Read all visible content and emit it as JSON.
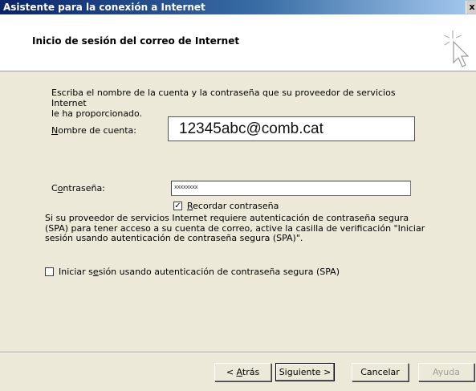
{
  "window": {
    "title": "Asistente para la conexión a Internet",
    "close_glyph": "x"
  },
  "header": {
    "heading": "Inicio de sesión del correo de Internet"
  },
  "form": {
    "intro_line1": "Escriba el nombre de la cuenta y la contraseña que su proveedor de servicios Internet",
    "intro_line2": "le ha proporcionado.",
    "account_label_key": "N",
    "account_label_rest": "ombre de cuenta:",
    "account_value": "12345abc@comb.cat",
    "password_label_pre": "C",
    "password_label_key": "o",
    "password_label_rest": "ntraseña:",
    "password_value": "xxxxxxxx",
    "remember_checked": true,
    "remember_label_key": "R",
    "remember_label_rest": "ecordar contraseña",
    "spa_line1": "Si su proveedor de servicios Internet requiere autenticación de contraseña segura",
    "spa_line2": "(SPA) para tener acceso a su cuenta de correo, active la casilla de verificación \"Iniciar",
    "spa_line3": "sesión usando autenticación de contraseña segura (SPA)\".",
    "spa_checked": false,
    "spa_label_pre": "Iniciar s",
    "spa_label_key": "e",
    "spa_label_rest": "sión usando autenticación de contraseña segura (SPA)"
  },
  "buttons": {
    "back_pre": "< ",
    "back_key": "A",
    "back_rest": "trás",
    "next": "Siguiente >",
    "cancel": "Cancelar",
    "help": "Ayuda"
  },
  "colors": {
    "title_bar": "#0a246a",
    "dialog_bg": "#ece9d8",
    "disabled_text": "#a0a0a0"
  },
  "icons": {
    "wizard": "cursor-sparkle-icon",
    "checkmark": "checkmark-icon"
  }
}
